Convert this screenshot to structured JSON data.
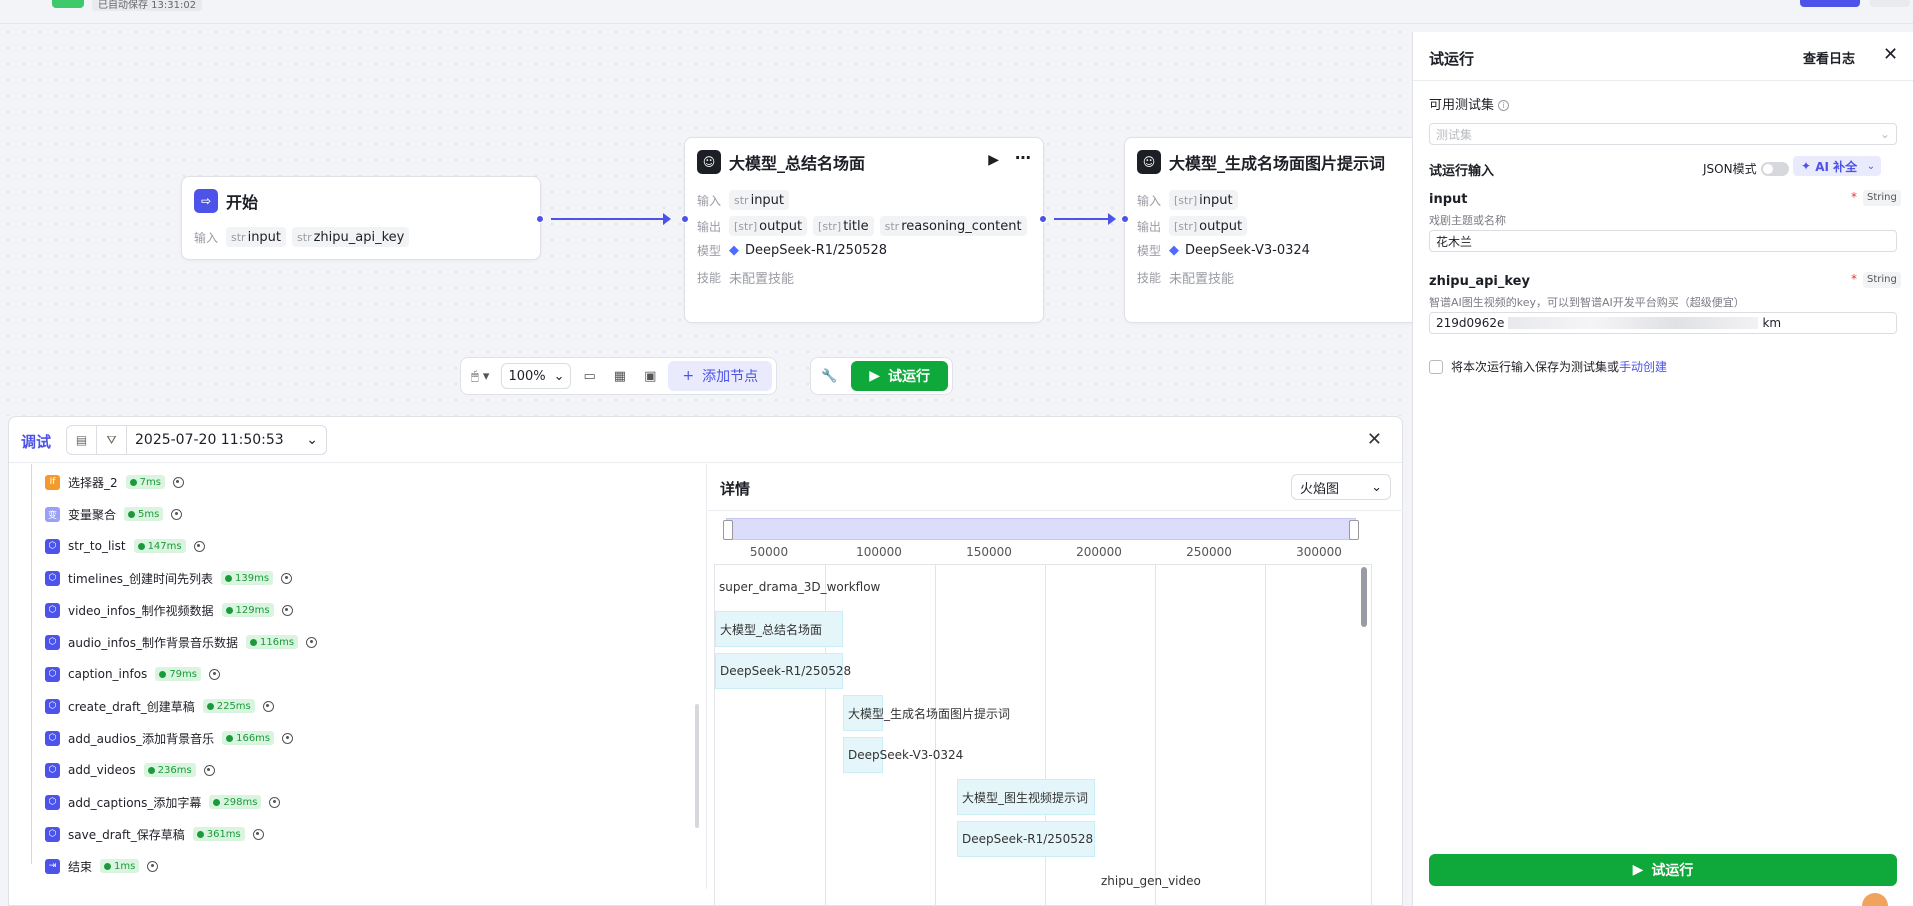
{
  "topbar": {
    "autosave": "已自动保存 13:31:02"
  },
  "nodes": {
    "start": {
      "title": "开始",
      "input_label": "输入",
      "inputs": [
        {
          "type": "str",
          "name": "input"
        },
        {
          "type": "str",
          "name": "zhipu_api_key"
        }
      ]
    },
    "summary": {
      "title": "大模型_总结名场面",
      "input_label": "输入",
      "output_label": "输出",
      "model_label": "模型",
      "skill_label": "技能",
      "inputs": [
        {
          "type": "str",
          "name": "input"
        }
      ],
      "outputs": [
        {
          "type": "[str]",
          "name": "output"
        },
        {
          "type": "[str]",
          "name": "title"
        },
        {
          "type": "str",
          "name": "reasoning_content"
        }
      ],
      "model": "DeepSeek-R1/250528",
      "skills": "未配置技能"
    },
    "image_prompt": {
      "title": "大模型_生成名场面图片提示词",
      "input_label": "输入",
      "output_label": "输出",
      "model_label": "模型",
      "skill_label": "技能",
      "inputs": [
        {
          "type": "[str]",
          "name": "input"
        }
      ],
      "outputs": [
        {
          "type": "[str]",
          "name": "output"
        }
      ],
      "model": "DeepSeek-V3-0324",
      "skills": "未配置技能"
    }
  },
  "toolbar": {
    "zoom": "100%",
    "add_node": "添加节点",
    "run": "试运行"
  },
  "debug": {
    "title": "调试",
    "datetime": "2025-07-20 11:50:53",
    "tree": [
      {
        "icon": "If",
        "name": "选择器_2",
        "time": "7ms",
        "color": "#f29a2e"
      },
      {
        "icon": "变",
        "name": "变量聚合",
        "time": "5ms",
        "color": "#9aa0f5"
      },
      {
        "icon": "⬡",
        "name": "str_to_list",
        "time": "147ms",
        "color": "#4d53e8"
      },
      {
        "icon": "⬡",
        "name": "timelines_创建时间先列表",
        "time": "139ms",
        "color": "#4d53e8"
      },
      {
        "icon": "⬡",
        "name": "video_infos_制作视频数据",
        "time": "129ms",
        "color": "#4d53e8"
      },
      {
        "icon": "⬡",
        "name": "audio_infos_制作背景音乐数据",
        "time": "116ms",
        "color": "#4d53e8"
      },
      {
        "icon": "⬡",
        "name": "caption_infos",
        "time": "79ms",
        "color": "#4d53e8"
      },
      {
        "icon": "⬡",
        "name": "create_draft_创建草稿",
        "time": "225ms",
        "color": "#4d53e8"
      },
      {
        "icon": "⬡",
        "name": "add_audios_添加背景音乐",
        "time": "166ms",
        "color": "#4d53e8"
      },
      {
        "icon": "⬡",
        "name": "add_videos",
        "time": "236ms",
        "color": "#4d53e8"
      },
      {
        "icon": "⬡",
        "name": "add_captions_添加字幕",
        "time": "298ms",
        "color": "#4d53e8"
      },
      {
        "icon": "⬡",
        "name": "save_draft_保存草稿",
        "time": "361ms",
        "color": "#4d53e8"
      },
      {
        "icon": "⇥",
        "name": "结束",
        "time": "1ms",
        "color": "#4d53e8"
      }
    ],
    "detail_title": "详情",
    "view_mode": "火焰图",
    "axis_ticks": [
      "50000",
      "100000",
      "150000",
      "200000",
      "250000",
      "300000"
    ],
    "flame_bars": [
      {
        "label": "super_drama_3D_workflow",
        "plain": true
      },
      {
        "label": "大模型_总结名场面"
      },
      {
        "label": "DeepSeek-R1/250528"
      },
      {
        "label": "大模型_生成名场面图片提示词"
      },
      {
        "label": "DeepSeek-V3-0324"
      },
      {
        "label": "大模型_图生视频提示词"
      },
      {
        "label": "DeepSeek-R1/250528"
      },
      {
        "label": "zhipu_gen_video",
        "plain": true
      }
    ]
  },
  "side": {
    "title": "试运行",
    "view_log": "查看日志",
    "testset_label": "可用测试集",
    "testset_placeholder": "测试集",
    "run_input_label": "试运行输入",
    "json_mode": "JSON模式",
    "ai_fill": "AI 补全",
    "fields": [
      {
        "name": "input",
        "type": "String",
        "desc": "戏剧主题或名称",
        "value": "花木兰"
      },
      {
        "name": "zhipu_api_key",
        "type": "String",
        "desc": "智谱AI图生视频的key，可以到智谱AI开发平台购买（超级便宜）",
        "value_start": "219d0962e",
        "value_end": "km"
      }
    ],
    "save_text": "将本次运行输入保存为测试集或",
    "save_link": "手动创建",
    "run": "试运行"
  }
}
